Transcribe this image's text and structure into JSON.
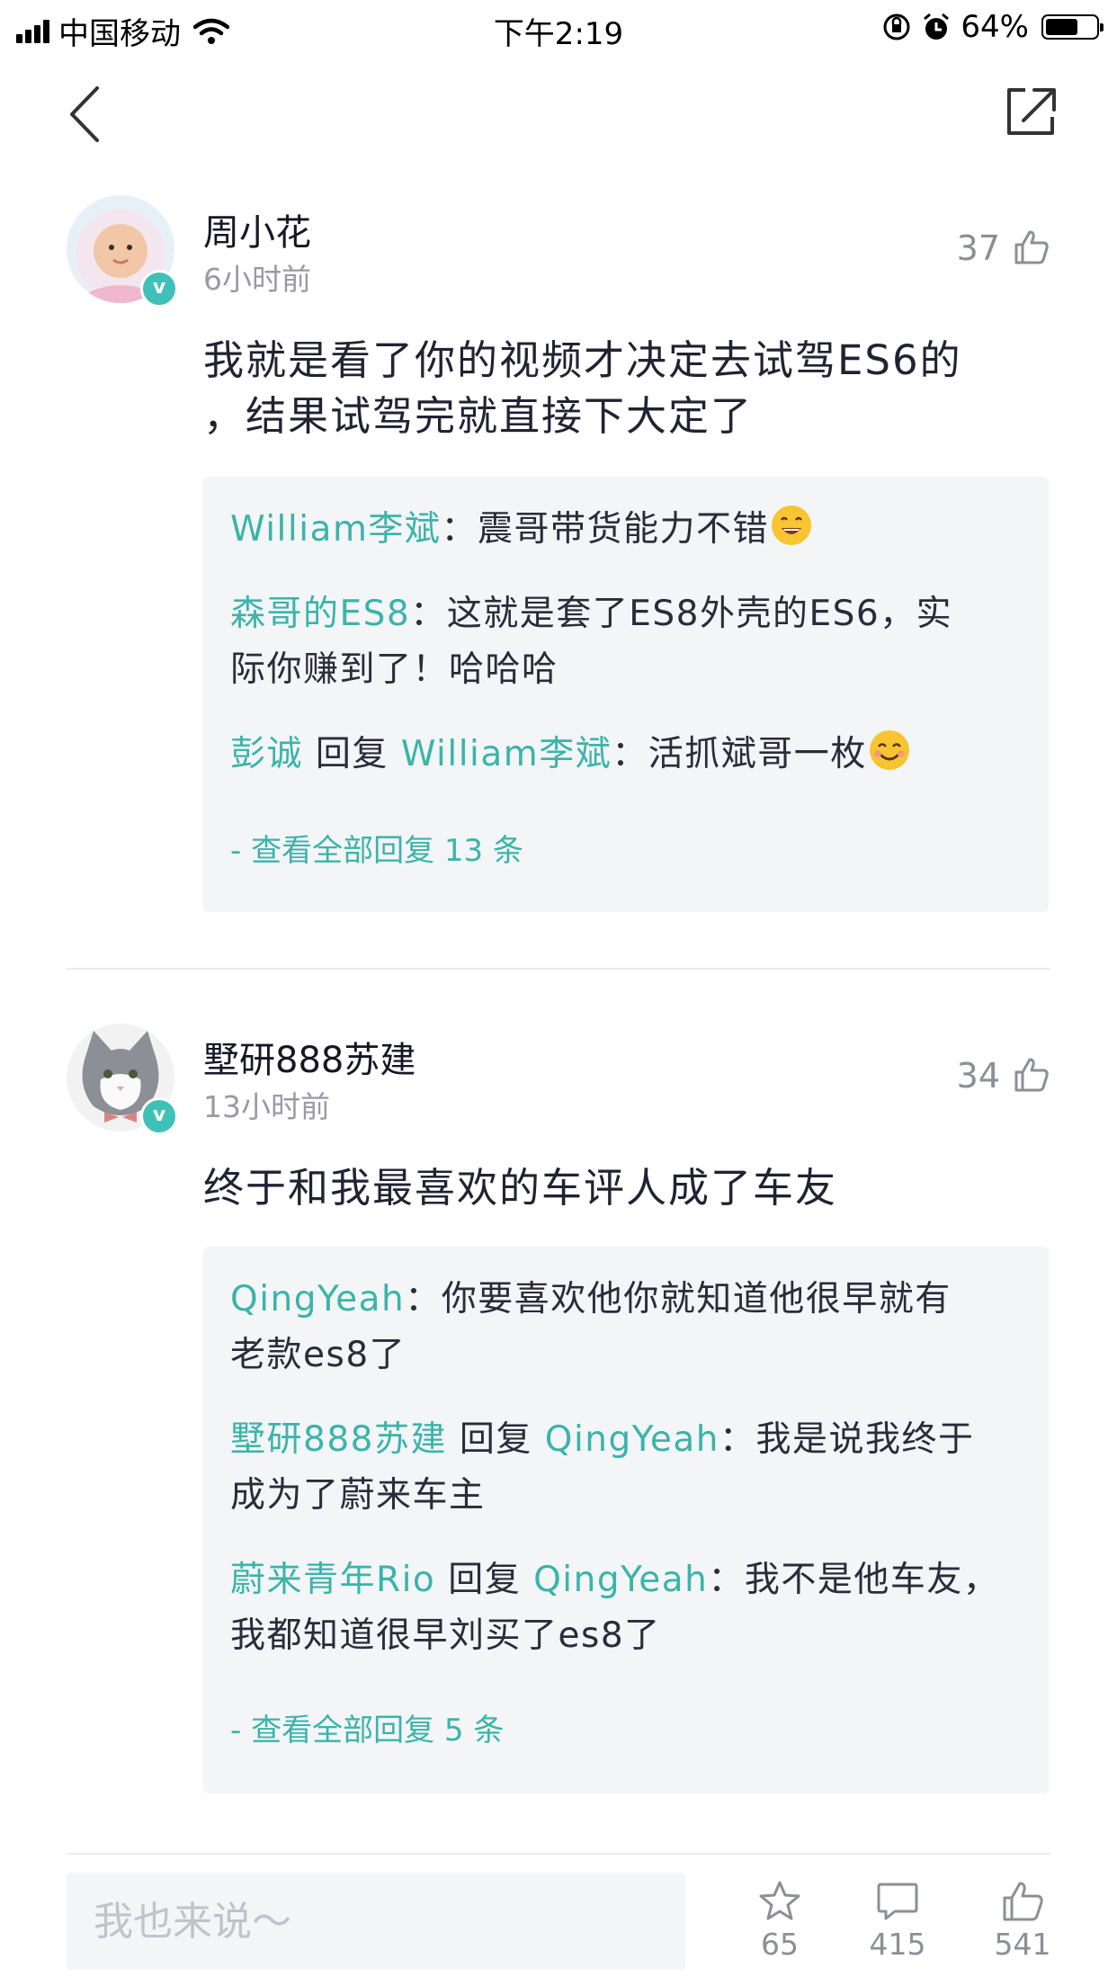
{
  "status_bar": {
    "carrier": "中国移动",
    "time": "下午2:19",
    "battery": "64%",
    "battery_level": 0.64
  },
  "comments": [
    {
      "user": "周小花",
      "time": "6小时前",
      "likes": "37",
      "text_line1": "我就是看了你的视频才决定去试驾ES6的",
      "text_line2": "，结果试驾完就直接下大定了",
      "replies": [
        {
          "name": "William李斌",
          "sep": "：",
          "text": "震哥带货能力不错"
        },
        {
          "name": "森哥的ES8",
          "sep": "：",
          "line1": "这就是套了ES8外壳的ES6，实",
          "line2": "际你赚到了！哈哈哈"
        },
        {
          "name": "彭诚",
          "reply_word": " 回复 ",
          "target": "William李斌",
          "sep": "：",
          "text": "活抓斌哥一枚"
        }
      ],
      "more": "- 查看全部回复 13 条"
    },
    {
      "user": "墅研888苏建",
      "time": "13小时前",
      "likes": "34",
      "text": "终于和我最喜欢的车评人成了车友",
      "replies": [
        {
          "name": "QingYeah",
          "sep": "：",
          "line1": "你要喜欢他你就知道他很早就有",
          "line2": "老款es8了"
        },
        {
          "name": "墅研888苏建",
          "reply_word": " 回复 ",
          "target": "QingYeah",
          "sep": "：",
          "line1": "我是说我终于",
          "line2": "成为了蔚来车主"
        },
        {
          "name": "蔚来青年Rio",
          "reply_word": " 回复 ",
          "target": "QingYeah",
          "sep": "：",
          "line1": "我不是他车友，",
          "line2": "我都知道很早刘买了es8了"
        }
      ],
      "more": "- 查看全部回复 5 条"
    }
  ],
  "bottom_bar": {
    "placeholder": "我也来说～",
    "favorites": "65",
    "comments": "415",
    "likes": "541"
  },
  "colors": {
    "accent": "#3bb4aa",
    "badge": "#3fc1b7",
    "reply_bg": "#f4f5f7"
  }
}
